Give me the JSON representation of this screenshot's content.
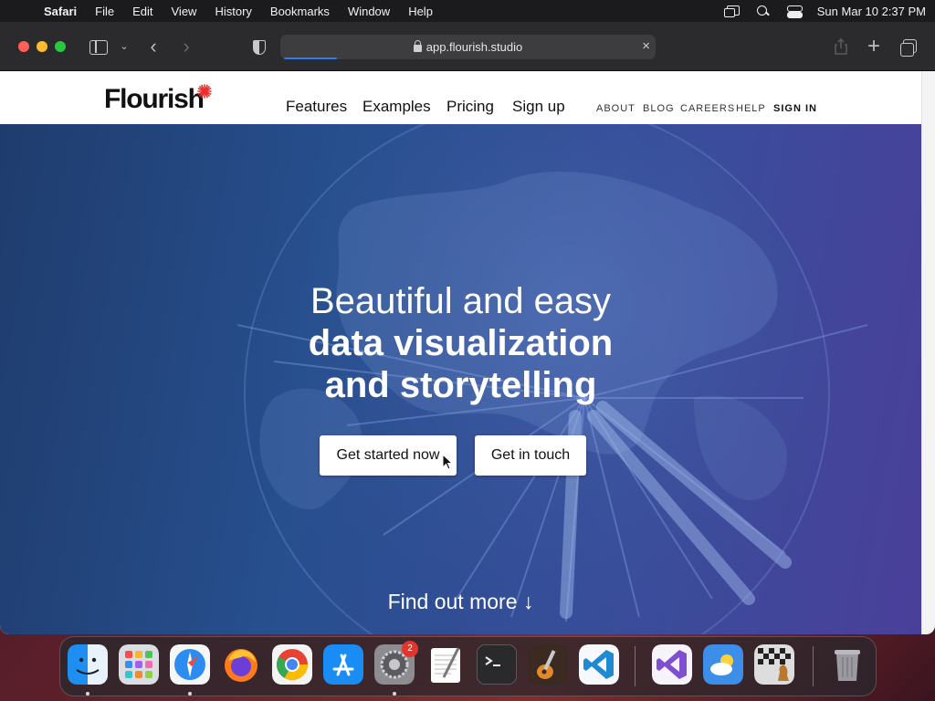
{
  "menubar": {
    "app_name": "Safari",
    "items": [
      "File",
      "Edit",
      "View",
      "History",
      "Bookmarks",
      "Window",
      "Help"
    ],
    "clock": "Sun Mar 10  2:37 PM"
  },
  "browser": {
    "url": "app.flourish.studio",
    "clear_icon": "×",
    "back_icon": "‹",
    "forward_icon": "›",
    "newtab_icon": "+",
    "chevron_icon": "⌄"
  },
  "site": {
    "logo_text": "Flourish",
    "logo_color": "#e8312f",
    "nav_main": [
      "Features",
      "Examples",
      "Pricing",
      "Sign up"
    ],
    "nav_small": [
      "ABOUT",
      "BLOG",
      "CAREERS",
      "HELP",
      "SIGN IN"
    ]
  },
  "hero": {
    "line1": "Beautiful and easy",
    "line2": "data visualization",
    "line3": "and storytelling",
    "primary_button": "Get started now",
    "secondary_button": "Get in touch",
    "find_more": "Find out more ↓"
  },
  "dock": {
    "apps": [
      "finder",
      "launchpad",
      "safari",
      "firefox",
      "chrome",
      "app-store",
      "system-settings",
      "textedit",
      "terminal",
      "garageband",
      "vscode",
      "visual-studio",
      "weather",
      "chess",
      "trash"
    ],
    "settings_badge": "2"
  }
}
